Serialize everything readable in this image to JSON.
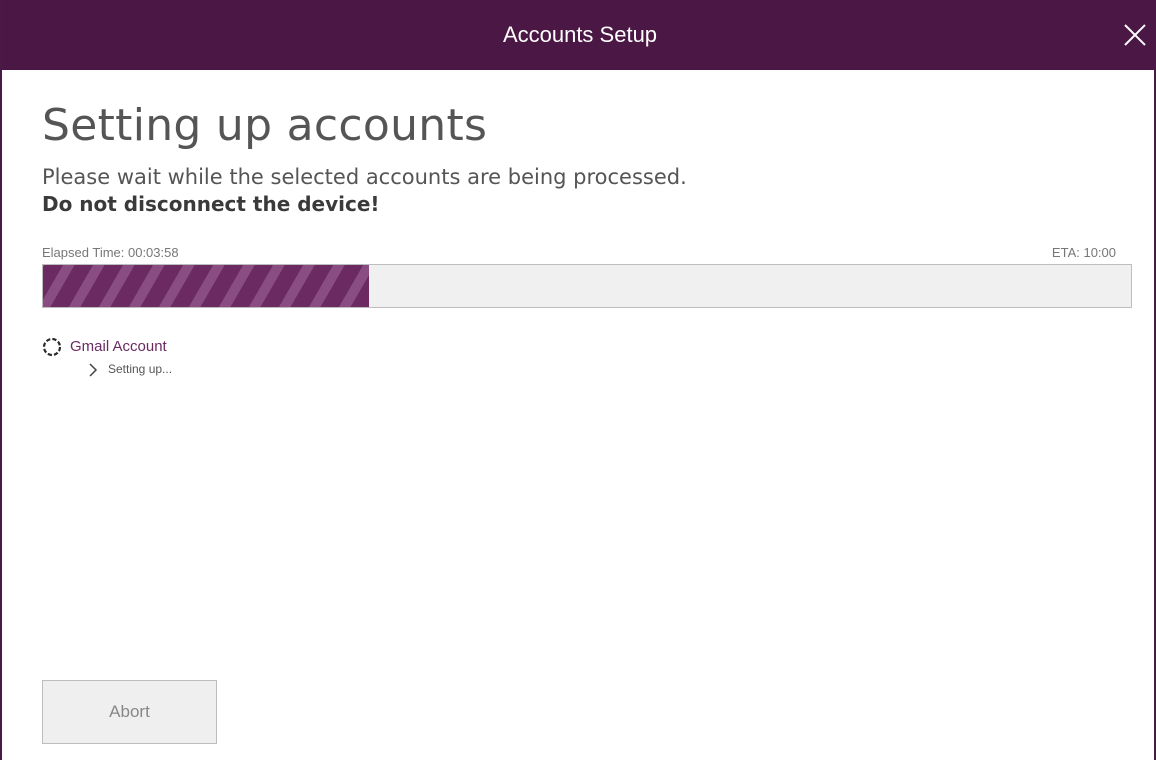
{
  "window": {
    "title": "Accounts Setup"
  },
  "colors": {
    "titlebar": "#4b1744",
    "accent": "#6b2a62"
  },
  "header": {
    "heading": "Setting up accounts",
    "subtext": "Please wait while the selected accounts are being processed.",
    "warning": "Do not disconnect the device!"
  },
  "progress": {
    "elapsed_label": "Elapsed Time: 00:03:58",
    "eta_label": "ETA: 10:00",
    "fraction": 0.3
  },
  "accounts": [
    {
      "label": "Gmail Account",
      "status": "Setting up..."
    }
  ],
  "actions": {
    "abort_label": "Abort"
  },
  "icons": {
    "close": "close-icon",
    "spinner": "spinner-icon",
    "chevron": "chevron-right-icon"
  }
}
